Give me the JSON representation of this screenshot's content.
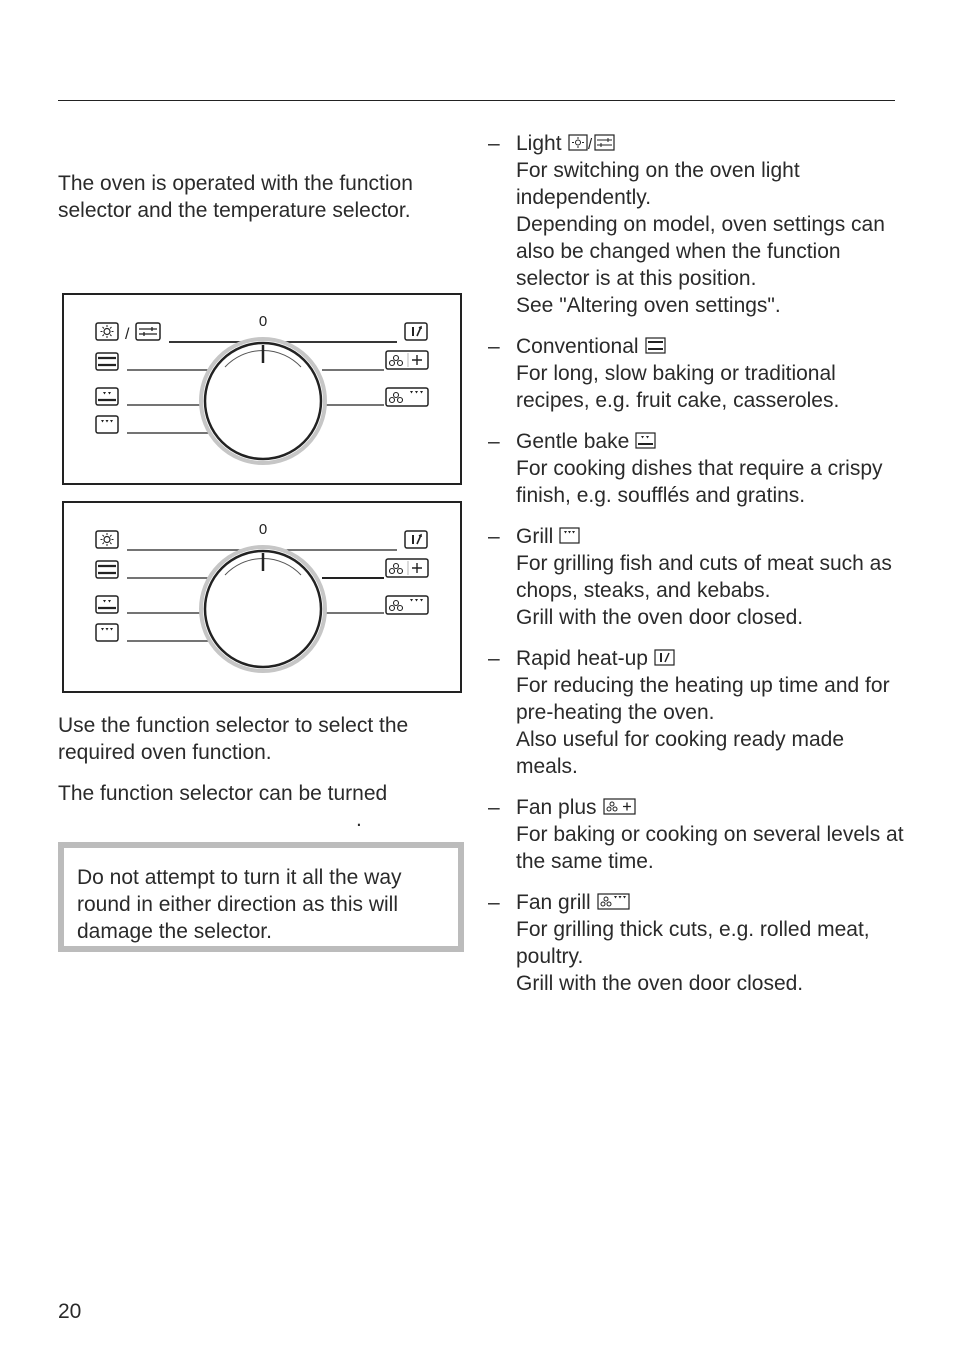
{
  "page": {
    "intro": "The oven is operated with the function selector and the temperature selector.",
    "use_text": "Use the function selector to select the required oven function.",
    "turn_text": "The function selector can be turned",
    "turn_trailing": ".",
    "warning": "Do not attempt to turn it all the way round in either direction as this will damage the selector.",
    "page_number": "20"
  },
  "diagrams": [
    {
      "zero_label": "0",
      "left_icons": [
        "light-settings-icon",
        "conventional-icon",
        "gentle-bake-icon",
        "grill-icon"
      ],
      "right_icons": [
        "rapid-heat-up-icon",
        "fan-plus-icon",
        "fan-grill-icon"
      ]
    },
    {
      "zero_label": "0",
      "left_icons": [
        "light-icon",
        "conventional-icon",
        "gentle-bake-icon",
        "grill-icon"
      ],
      "right_icons": [
        "rapid-heat-up-icon",
        "fan-plus-icon",
        "fan-grill-icon"
      ]
    }
  ],
  "functions": [
    {
      "dash": "–",
      "title": "Light",
      "icon": "light-settings-icon",
      "lines": [
        "For switching on the oven light independently.",
        "Depending on model, oven settings can also be changed when the function selector is at this position.",
        "See \"Altering oven settings\"."
      ]
    },
    {
      "dash": "–",
      "title": "Conventional",
      "icon": "conventional-icon",
      "lines": [
        "For long, slow baking or traditional recipes, e.g. fruit cake, casseroles."
      ]
    },
    {
      "dash": "–",
      "title": "Gentle bake",
      "icon": "gentle-bake-icon",
      "lines": [
        "For cooking dishes that require a crispy finish, e.g. soufflés and gratins."
      ]
    },
    {
      "dash": "–",
      "title": "Grill",
      "icon": "grill-icon",
      "lines": [
        "For grilling fish and cuts of meat such as chops, steaks, and kebabs.",
        "Grill with the oven door closed."
      ]
    },
    {
      "dash": "–",
      "title": "Rapid heat-up",
      "icon": "rapid-heat-up-icon",
      "lines": [
        "For reducing the heating up time and for pre-heating the oven.",
        "Also useful for cooking ready made meals."
      ]
    },
    {
      "dash": "–",
      "title": "Fan plus",
      "icon": "fan-plus-icon",
      "lines": [
        "For baking or cooking on several levels at the same time."
      ]
    },
    {
      "dash": "–",
      "title": "Fan grill",
      "icon": "fan-grill-icon",
      "lines": [
        "For grilling thick cuts, e.g. rolled meat, poultry.",
        "Grill with the oven door closed."
      ]
    }
  ]
}
